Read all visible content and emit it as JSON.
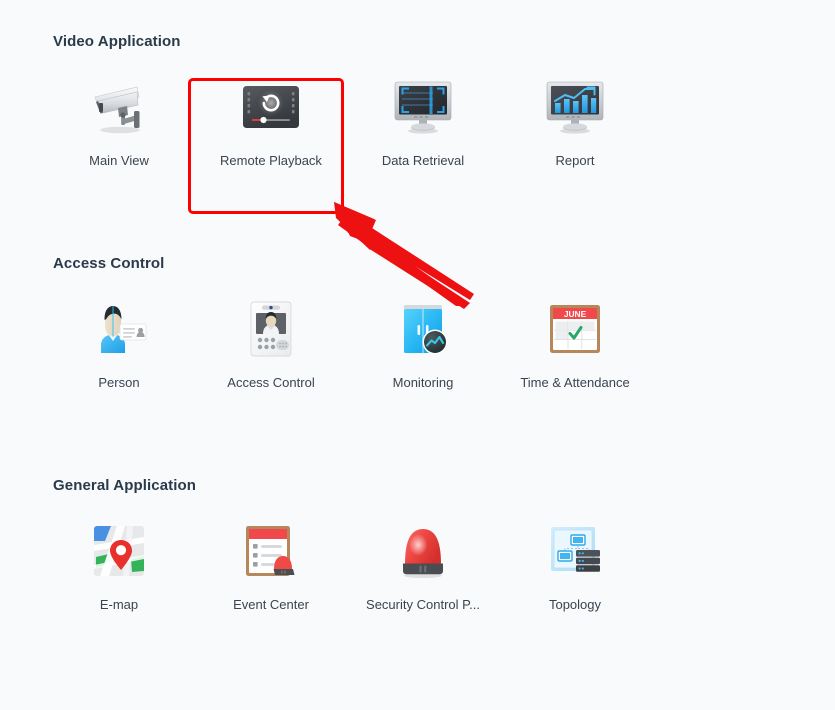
{
  "page": {
    "background_color": "#f8fafc",
    "heading_color": "#2b3a4a",
    "label_color": "#3a4450",
    "highlight_color": "#ff0000"
  },
  "sections": [
    {
      "id": "video-application",
      "title": "Video Application",
      "items": [
        {
          "id": "main-view",
          "label": "Main View",
          "icon": "security-camera-icon"
        },
        {
          "id": "remote-playback",
          "label": "Remote Playback",
          "icon": "playback-screen-icon"
        },
        {
          "id": "data-retrieval",
          "label": "Data Retrieval",
          "icon": "monitor-search-icon"
        },
        {
          "id": "report",
          "label": "Report",
          "icon": "monitor-chart-icon"
        }
      ]
    },
    {
      "id": "access-control",
      "title": "Access Control",
      "items": [
        {
          "id": "person",
          "label": "Person",
          "icon": "person-card-icon"
        },
        {
          "id": "access-control",
          "label": "Access Control",
          "icon": "access-terminal-icon"
        },
        {
          "id": "monitoring",
          "label": "Monitoring",
          "icon": "door-monitoring-icon"
        },
        {
          "id": "time-attendance",
          "label": "Time & Attendance",
          "icon": "calendar-check-icon"
        }
      ]
    },
    {
      "id": "general-application",
      "title": "General Application",
      "items": [
        {
          "id": "e-map",
          "label": "E-map",
          "icon": "map-pin-icon"
        },
        {
          "id": "event-center",
          "label": "Event Center",
          "icon": "event-alarm-icon"
        },
        {
          "id": "security-control-panel",
          "label": "Security Control P...",
          "icon": "alarm-beacon-icon"
        },
        {
          "id": "topology",
          "label": "Topology",
          "icon": "network-topology-icon"
        }
      ]
    }
  ],
  "annotations": {
    "highlight": {
      "target": "remote-playback",
      "color": "#ff0000"
    },
    "arrow": {
      "points_to": "remote-playback",
      "color": "#ff0000"
    }
  },
  "calendar_icon": {
    "month_label": "JUNE"
  }
}
